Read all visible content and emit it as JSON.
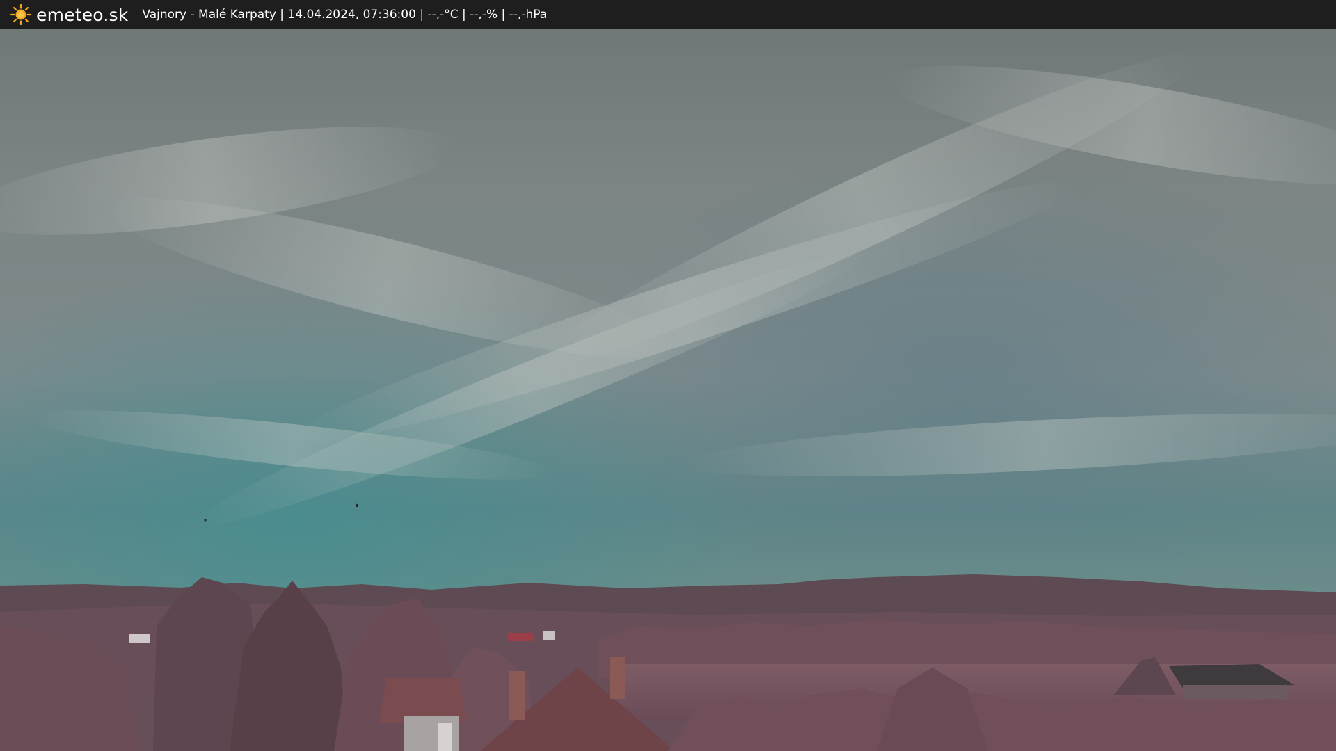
{
  "header": {
    "logo_icon": "sun-icon",
    "brand": "emeteo.sk",
    "caption": "Vajnory - Malé Karpaty | 14.04.2024, 07:36:00 | --,-°C | --,-% | --,-hPa"
  },
  "colors": {
    "bar_background": "#1e1e1e",
    "bar_text": "#ffffff",
    "sun": "#f6a81c"
  }
}
